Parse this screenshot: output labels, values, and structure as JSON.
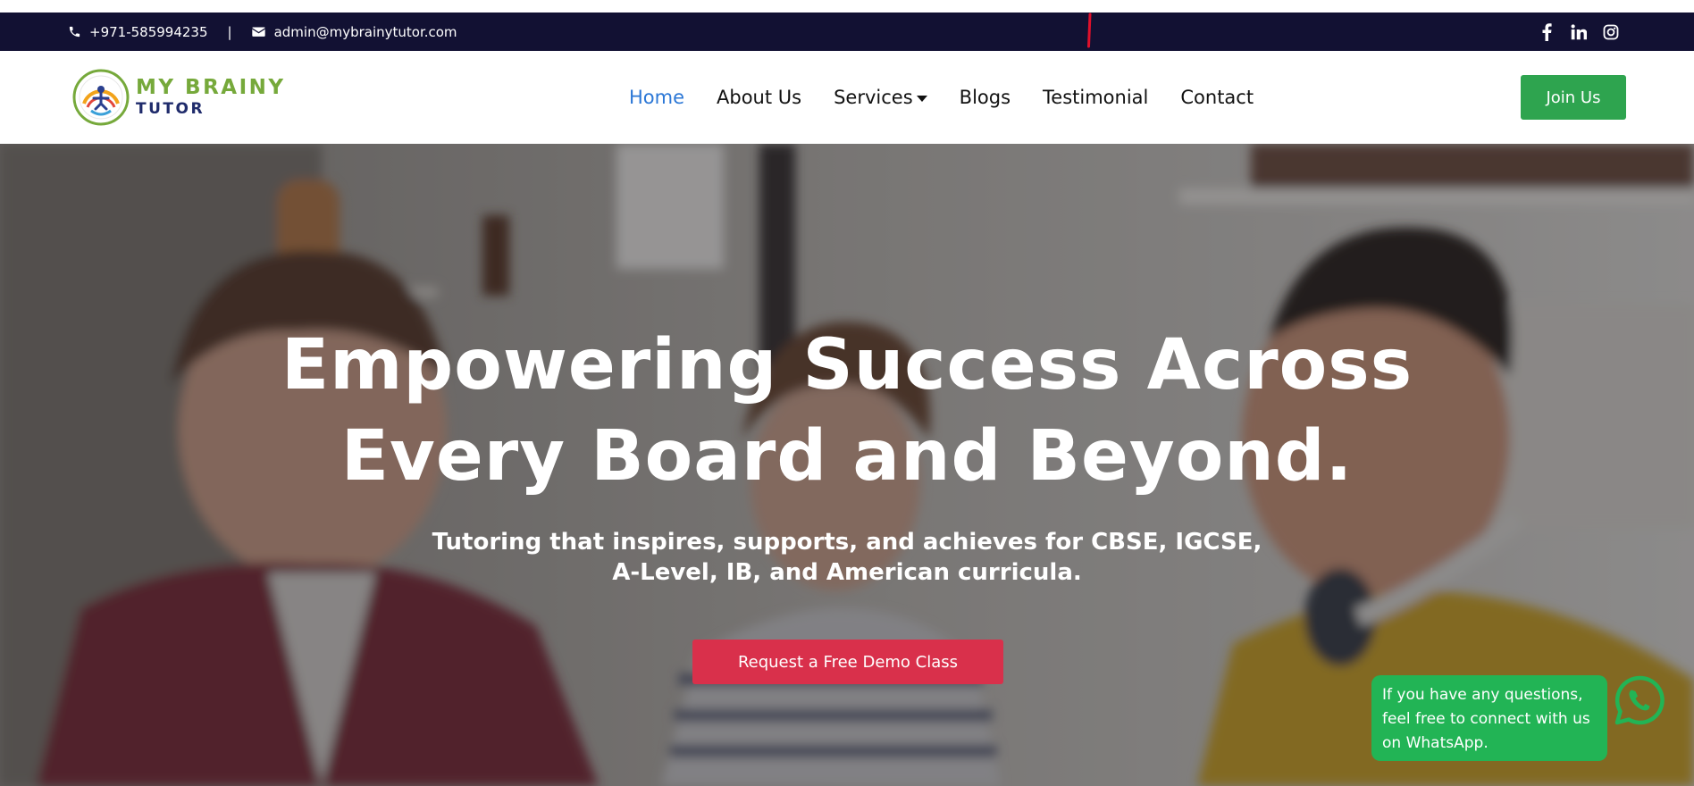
{
  "topbar": {
    "phone": "+971-585994235",
    "separator": "|",
    "email": "admin@mybrainytutor.com",
    "social": [
      "facebook-icon",
      "linkedin-icon",
      "instagram-icon"
    ]
  },
  "brand": {
    "line1": "MY BRAINY",
    "line2": "TUTOR"
  },
  "nav": {
    "items": [
      {
        "label": "Home",
        "active": true
      },
      {
        "label": "About Us"
      },
      {
        "label": "Services",
        "dropdown": true
      },
      {
        "label": "Blogs"
      },
      {
        "label": "Testimonial"
      },
      {
        "label": "Contact"
      }
    ],
    "join_label": "Join Us"
  },
  "hero": {
    "title_line1": "Empowering Success Across",
    "title_line2": "Every Board and Beyond.",
    "subtitle_line1": "Tutoring that inspires, supports, and achieves for CBSE, IGCSE,",
    "subtitle_line2": "A-Level, IB, and American curricula.",
    "cta_label": "Request a Free Demo Class"
  },
  "whatsapp": {
    "message": "If you have any questions,\nfeel free to connect with us\non WhatsApp."
  },
  "colors": {
    "topbar_bg": "#121133",
    "active_link": "#2b77d6",
    "join_button": "#2ea44f",
    "cta_button": "#d9304b",
    "whatsapp": "#22b455"
  }
}
